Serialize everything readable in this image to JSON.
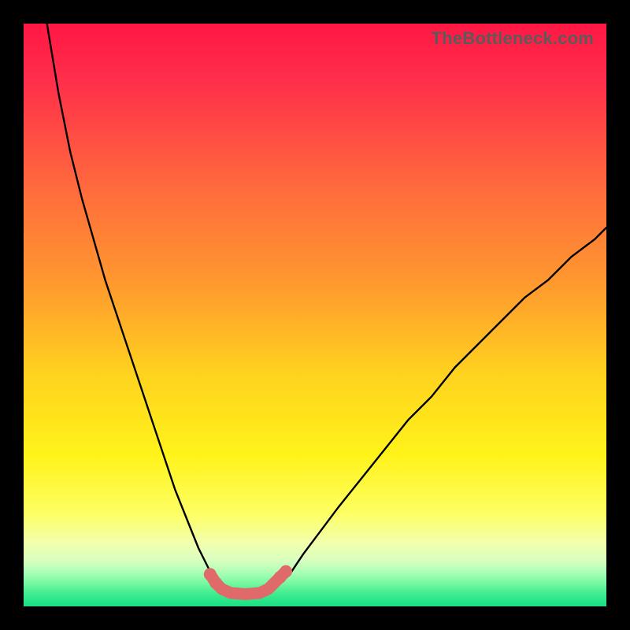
{
  "watermark": "TheBottleneck.com",
  "chart_data": {
    "type": "line",
    "title": "",
    "xlabel": "",
    "ylabel": "",
    "xlim": [
      0,
      100
    ],
    "ylim": [
      0,
      100
    ],
    "series": [
      {
        "name": "left-curve",
        "x": [
          4,
          6,
          8,
          10,
          12,
          14,
          16,
          18,
          20,
          22,
          24,
          26,
          28,
          30,
          32,
          33.5
        ],
        "values": [
          100,
          88,
          78,
          70,
          63,
          56,
          50,
          44,
          38,
          32,
          26,
          20,
          15,
          10,
          6,
          4
        ]
      },
      {
        "name": "right-curve",
        "x": [
          44,
          46,
          48,
          51,
          54,
          58,
          62,
          66,
          70,
          74,
          78,
          82,
          86,
          90,
          94,
          98,
          100
        ],
        "values": [
          4,
          6,
          9,
          13,
          17,
          22,
          27,
          32,
          36,
          41,
          45,
          49,
          53,
          56,
          60,
          63,
          65
        ]
      },
      {
        "name": "trough-highlight",
        "x": [
          32,
          33,
          34,
          35.5,
          38,
          40.5,
          42,
          43,
          44,
          45
        ],
        "values": [
          5.5,
          4,
          3,
          2.3,
          2.1,
          2.3,
          3,
          4,
          5,
          6
        ]
      }
    ],
    "gradient_stops": [
      {
        "offset": 0.0,
        "color": "#ff1744"
      },
      {
        "offset": 0.1,
        "color": "#ff2f4a"
      },
      {
        "offset": 0.28,
        "color": "#ff6a3d"
      },
      {
        "offset": 0.45,
        "color": "#ff9a2e"
      },
      {
        "offset": 0.6,
        "color": "#ffd21f"
      },
      {
        "offset": 0.74,
        "color": "#fff31a"
      },
      {
        "offset": 0.84,
        "color": "#fdff62"
      },
      {
        "offset": 0.89,
        "color": "#f3ffad"
      },
      {
        "offset": 0.92,
        "color": "#daffbf"
      },
      {
        "offset": 0.94,
        "color": "#b0ffb8"
      },
      {
        "offset": 0.96,
        "color": "#76f9a1"
      },
      {
        "offset": 0.98,
        "color": "#3ceb8f"
      },
      {
        "offset": 1.0,
        "color": "#18e084"
      }
    ]
  }
}
